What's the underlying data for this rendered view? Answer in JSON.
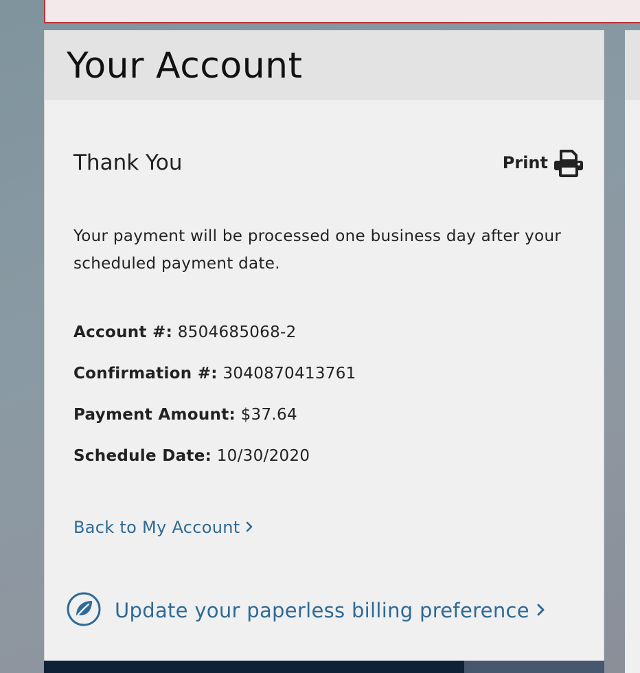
{
  "card": {
    "title": "Your Account"
  },
  "confirmation": {
    "heading": "Thank You",
    "print_label": "Print",
    "message": "Your payment will be processed one business day after your scheduled payment date."
  },
  "details": [
    {
      "label": "Account #:",
      "value": "8504685068-2"
    },
    {
      "label": "Confirmation #:",
      "value": "3040870413761"
    },
    {
      "label": "Payment Amount:",
      "value": "$37.64"
    },
    {
      "label": "Schedule Date:",
      "value": "10/30/2020"
    }
  ],
  "links": {
    "back": "Back to My Account",
    "paperless": "Update your paperless billing preference"
  },
  "icons": {
    "print": "printer-icon",
    "leaf": "leaf-icon",
    "chevron": "chevron-right-icon"
  },
  "colors": {
    "link": "#2e6a96",
    "alert_border": "#b9333a",
    "footer": "#0f2137"
  }
}
